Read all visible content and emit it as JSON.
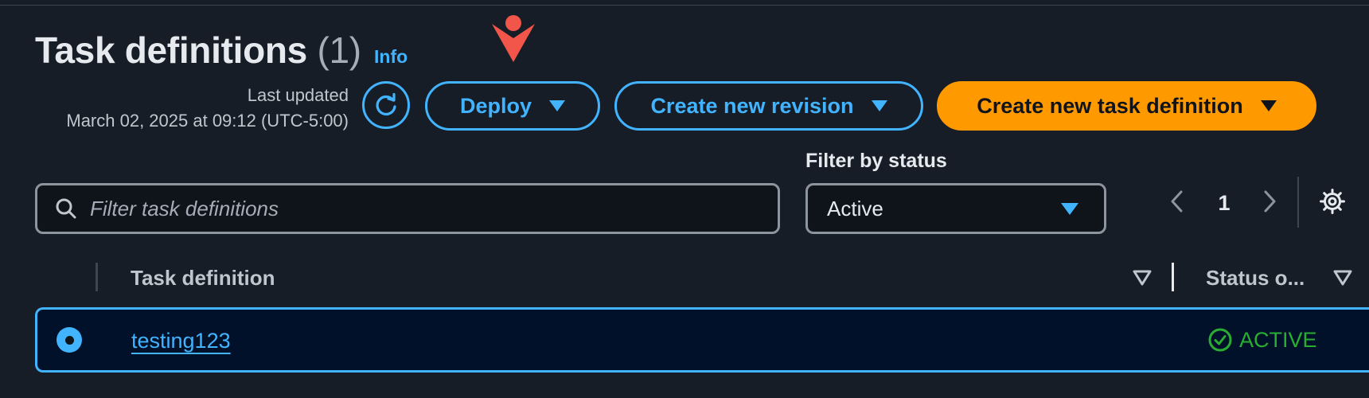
{
  "header": {
    "title": "Task definitions",
    "count": "(1)",
    "info_link": "Info",
    "last_updated_label": "Last updated",
    "last_updated_value": "March 02, 2025 at 09:12 (UTC-5:00)"
  },
  "actions": {
    "deploy_label": "Deploy",
    "create_revision_label": "Create new revision",
    "create_task_label": "Create new task definition"
  },
  "filters": {
    "search_placeholder": "Filter task definitions",
    "search_value": "",
    "status_label": "Filter by status",
    "status_selected": "Active"
  },
  "pagination": {
    "current_page": "1"
  },
  "table": {
    "columns": [
      "Task definition",
      "Status o..."
    ],
    "rows": [
      {
        "name": "testing123",
        "status": "ACTIVE",
        "selected": true
      }
    ]
  },
  "colors": {
    "background": "#161d26",
    "accent": "#42b4ff",
    "primary_button": "#ff9900",
    "success": "#29ad32",
    "annotation_arrow": "#f2564a"
  },
  "icons": {
    "refresh": "refresh-icon",
    "search": "search-icon",
    "settings": "gear-icon",
    "prev": "chevron-left-icon",
    "next": "chevron-right-icon",
    "sort": "sort-down-icon",
    "status_ok": "check-circle-icon"
  }
}
